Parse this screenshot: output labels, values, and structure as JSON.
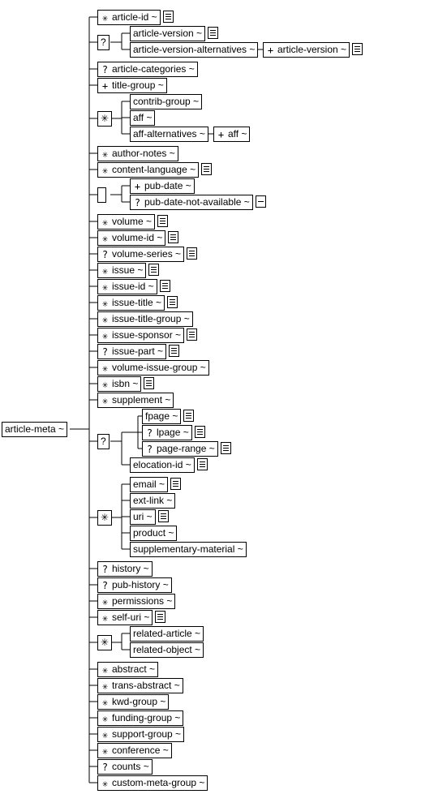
{
  "root": {
    "label": "article-meta ~"
  },
  "nodes": {
    "article_id": {
      "occ": "✳",
      "label": "article-id ~",
      "doc": true
    },
    "choice1": {
      "occ": "?",
      "label": ""
    },
    "article_version": {
      "occ": "",
      "label": "article-version ~",
      "doc": true
    },
    "article_version_alt": {
      "occ": "",
      "label": "article-version-alternatives ~"
    },
    "av_child": {
      "occ": "+",
      "label": "article-version ~",
      "doc": true,
      "dark": true
    },
    "article_categories": {
      "occ": "?",
      "label": "article-categories ~"
    },
    "title_group": {
      "occ": "+",
      "label": "title-group ~"
    },
    "choice2": {
      "occ": "✳",
      "label": ""
    },
    "contrib_group": {
      "occ": "",
      "label": "contrib-group ~"
    },
    "aff": {
      "occ": "",
      "label": "aff ~"
    },
    "aff_alt": {
      "occ": "",
      "label": "aff-alternatives ~"
    },
    "aff_child": {
      "occ": "+",
      "label": "aff ~"
    },
    "author_notes": {
      "occ": "✳",
      "label": "author-notes ~"
    },
    "content_language": {
      "occ": "✳",
      "label": "content-language ~",
      "doc": true
    },
    "choice3": {
      "occ": "",
      "label": ""
    },
    "pub_date": {
      "occ": "+",
      "label": "pub-date ~"
    },
    "pub_date_na": {
      "occ": "?",
      "label": "pub-date-not-available ~",
      "minus": true
    },
    "volume": {
      "occ": "✳",
      "label": "volume ~",
      "doc": true
    },
    "volume_id": {
      "occ": "✳",
      "label": "volume-id ~",
      "doc": true
    },
    "volume_series": {
      "occ": "?",
      "label": "volume-series ~",
      "doc": true
    },
    "issue": {
      "occ": "✳",
      "label": "issue ~",
      "doc": true
    },
    "issue_id": {
      "occ": "✳",
      "label": "issue-id ~",
      "doc": true
    },
    "issue_title": {
      "occ": "✳",
      "label": "issue-title ~",
      "doc": true
    },
    "issue_title_group": {
      "occ": "✳",
      "label": "issue-title-group ~"
    },
    "issue_sponsor": {
      "occ": "✳",
      "label": "issue-sponsor ~",
      "doc": true
    },
    "issue_part": {
      "occ": "?",
      "label": "issue-part ~",
      "doc": true
    },
    "volume_issue_group": {
      "occ": "✳",
      "label": "volume-issue-group ~"
    },
    "isbn": {
      "occ": "✳",
      "label": "isbn ~",
      "doc": true
    },
    "supplement": {
      "occ": "✳",
      "label": "supplement ~"
    },
    "choice4": {
      "occ": "?",
      "label": ""
    },
    "fpage": {
      "occ": "",
      "label": "fpage ~",
      "doc": true
    },
    "lpage": {
      "occ": "?",
      "label": "lpage ~",
      "doc": true
    },
    "page_range": {
      "occ": "?",
      "label": "page-range ~",
      "doc": true
    },
    "elocation_id": {
      "occ": "",
      "label": "elocation-id ~",
      "doc": true
    },
    "choice5": {
      "occ": "✳",
      "label": ""
    },
    "email": {
      "occ": "",
      "label": "email ~",
      "doc": true
    },
    "ext_link": {
      "occ": "",
      "label": "ext-link ~"
    },
    "uri": {
      "occ": "",
      "label": "uri ~",
      "doc": true
    },
    "product": {
      "occ": "",
      "label": "product ~"
    },
    "supp_mat": {
      "occ": "",
      "label": "supplementary-material ~"
    },
    "history": {
      "occ": "?",
      "label": "history ~"
    },
    "pub_history": {
      "occ": "?",
      "label": "pub-history ~"
    },
    "permissions": {
      "occ": "✳",
      "label": "permissions ~"
    },
    "self_uri": {
      "occ": "✳",
      "label": "self-uri ~",
      "doc": true
    },
    "choice6": {
      "occ": "✳",
      "label": ""
    },
    "related_article": {
      "occ": "",
      "label": "related-article ~"
    },
    "related_object": {
      "occ": "",
      "label": "related-object ~"
    },
    "abstract": {
      "occ": "✳",
      "label": "abstract ~"
    },
    "trans_abstract": {
      "occ": "✳",
      "label": "trans-abstract ~"
    },
    "kwd_group": {
      "occ": "✳",
      "label": "kwd-group ~"
    },
    "funding_group": {
      "occ": "✳",
      "label": "funding-group ~"
    },
    "support_group": {
      "occ": "✳",
      "label": "support-group ~"
    },
    "conference": {
      "occ": "✳",
      "label": "conference ~"
    },
    "counts": {
      "occ": "?",
      "label": "counts ~"
    },
    "custom_meta_group": {
      "occ": "✳",
      "label": "custom-meta-group ~"
    }
  }
}
